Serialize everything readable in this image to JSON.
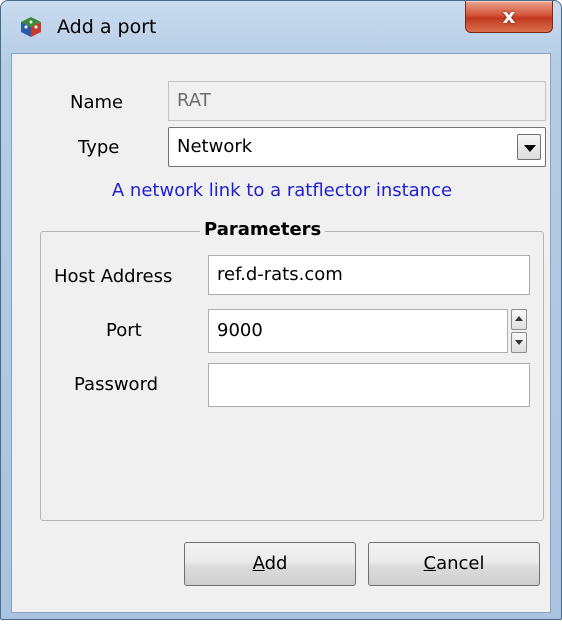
{
  "window": {
    "title": "Add a port",
    "close_label": "x"
  },
  "form": {
    "name_label": "Name",
    "name_value": "RAT",
    "type_label": "Type",
    "type_value": "Network",
    "type_description": "A network link to a ratflector instance"
  },
  "parameters": {
    "title": "Parameters",
    "host_label": "Host Address",
    "host_value": "ref.d-rats.com",
    "port_label": "Port",
    "port_value": "9000",
    "password_label": "Password",
    "password_value": ""
  },
  "buttons": {
    "add_mnemonic": "A",
    "add_rest": "dd",
    "cancel_mnemonic": "C",
    "cancel_rest": "ancel"
  },
  "colors": {
    "description_text": "#1f1fcf",
    "close_button": "#c2381f"
  }
}
